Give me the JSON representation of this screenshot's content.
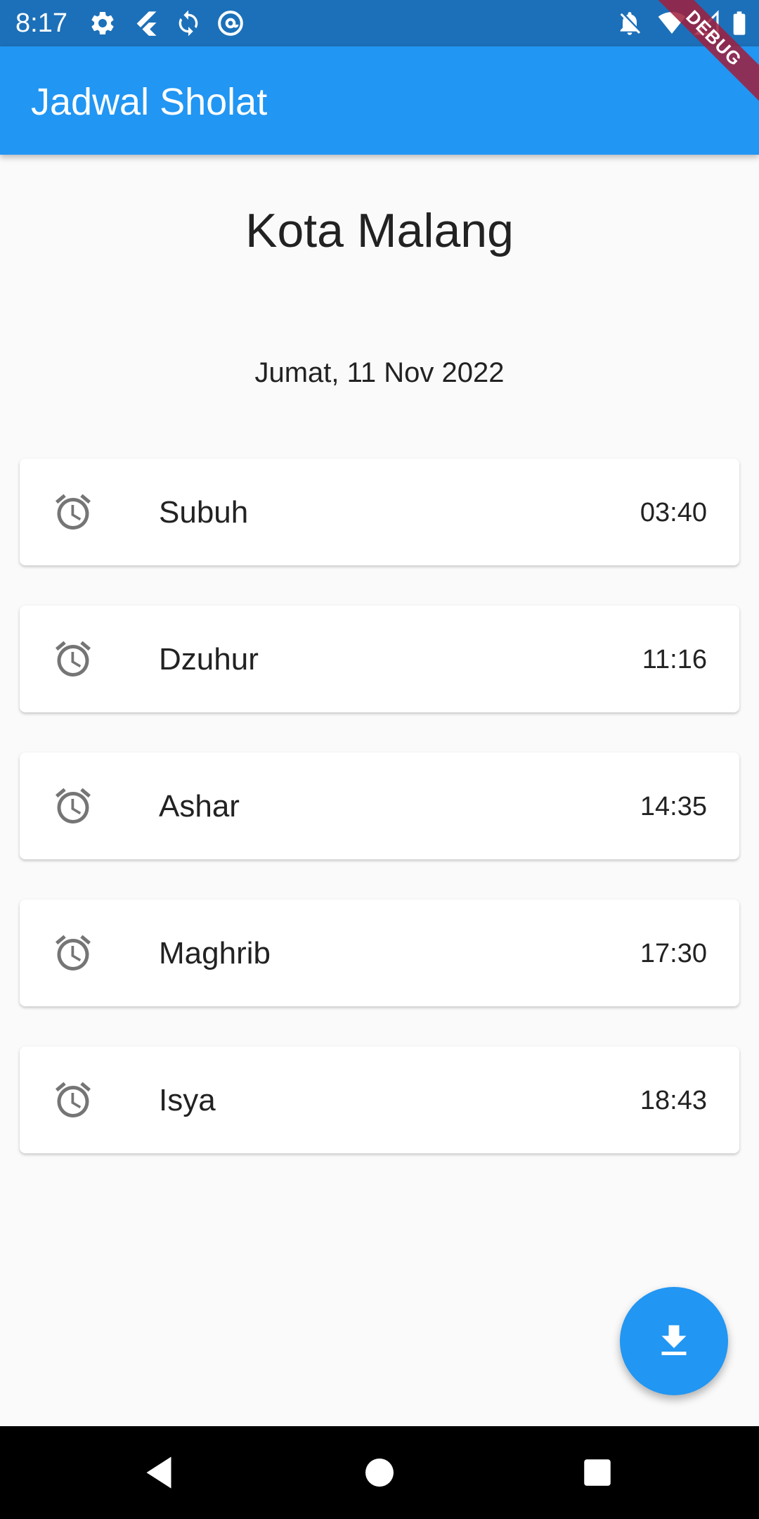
{
  "status_bar": {
    "time": "8:17",
    "left_icons": [
      "gear-icon",
      "flutter-icon",
      "sync-icon",
      "at-sign-icon"
    ],
    "right_icons": [
      "notifications-off-icon",
      "wifi-icon",
      "signal-icon",
      "battery-icon"
    ]
  },
  "debug_banner": "DEBUG",
  "app_bar": {
    "title": "Jadwal Sholat"
  },
  "location": {
    "city": "Kota Malang",
    "date": "Jumat, 11 Nov 2022"
  },
  "prayers": [
    {
      "name": "Subuh",
      "time": "03:40",
      "icon": "alarm-icon"
    },
    {
      "name": "Dzuhur",
      "time": "11:16",
      "icon": "alarm-icon"
    },
    {
      "name": "Ashar",
      "time": "14:35",
      "icon": "alarm-icon"
    },
    {
      "name": "Maghrib",
      "time": "17:30",
      "icon": "alarm-icon"
    },
    {
      "name": "Isya",
      "time": "18:43",
      "icon": "alarm-icon"
    }
  ],
  "fab": {
    "icon": "download-icon"
  },
  "nav_bar": {
    "buttons": [
      "back-icon",
      "home-icon",
      "recents-icon"
    ]
  },
  "colors": {
    "primary": "#2196f3",
    "status_bar": "#1c70b9",
    "background": "#fafafa",
    "icon_gray": "#757575"
  }
}
